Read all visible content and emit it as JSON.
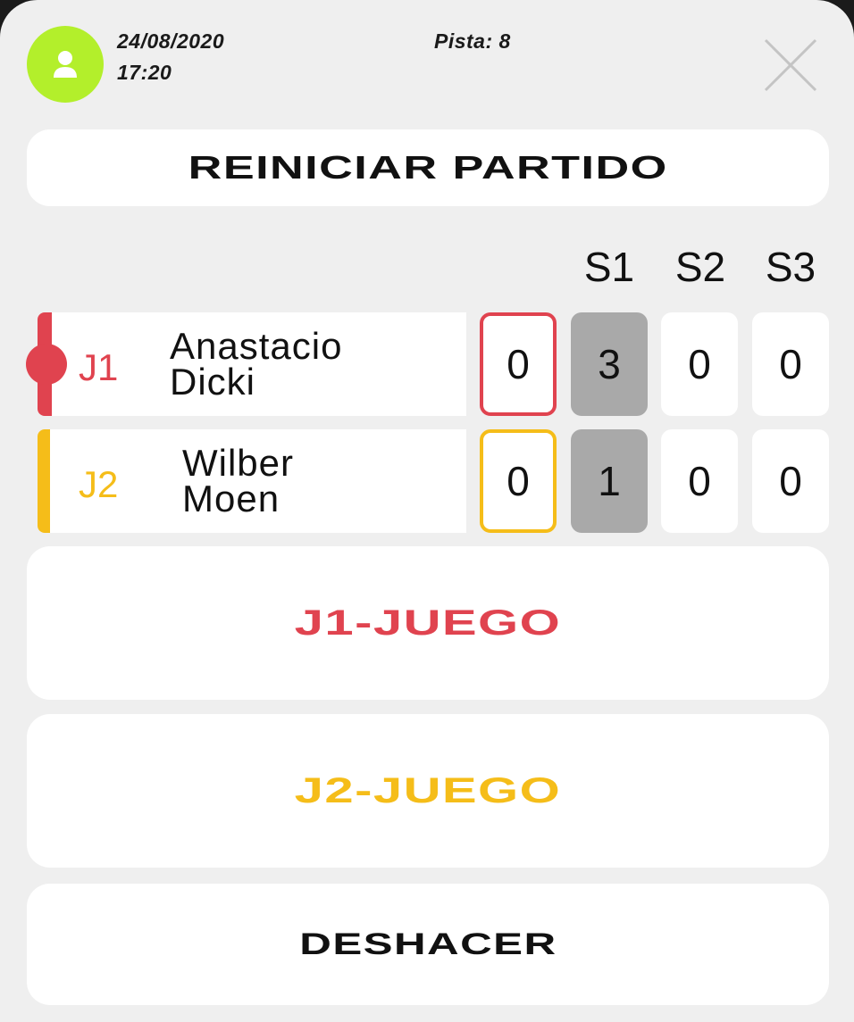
{
  "header": {
    "date": "24/08/2020",
    "time": "17:20",
    "court": "Pista: 8"
  },
  "actions": {
    "restart": "REINICIAR PARTIDO",
    "j1_game": "J1-JUEGO",
    "j2_game": "J2-JUEGO",
    "undo": "DESHACER"
  },
  "sets": [
    "S1",
    "S2",
    "S3"
  ],
  "players": [
    {
      "tag": "J1",
      "first_name": "Anastacio",
      "last_name": "Dicki",
      "current_game": "0",
      "set_scores": [
        "3",
        "0",
        "0"
      ],
      "color": "#e0434f"
    },
    {
      "tag": "J2",
      "first_name": "Wilber",
      "last_name": "Moen",
      "current_game": "0",
      "set_scores": [
        "1",
        "0",
        "0"
      ],
      "color": "#f5bd19"
    }
  ],
  "icons": {
    "avatar": "user-icon",
    "close": "close-icon",
    "serve": "serve-indicator-dot"
  },
  "colors": {
    "avatar_bg": "#b3ef2b",
    "active_set_bg": "#a9a9a9",
    "j1": "#e0434f",
    "j2": "#f5bd19"
  }
}
